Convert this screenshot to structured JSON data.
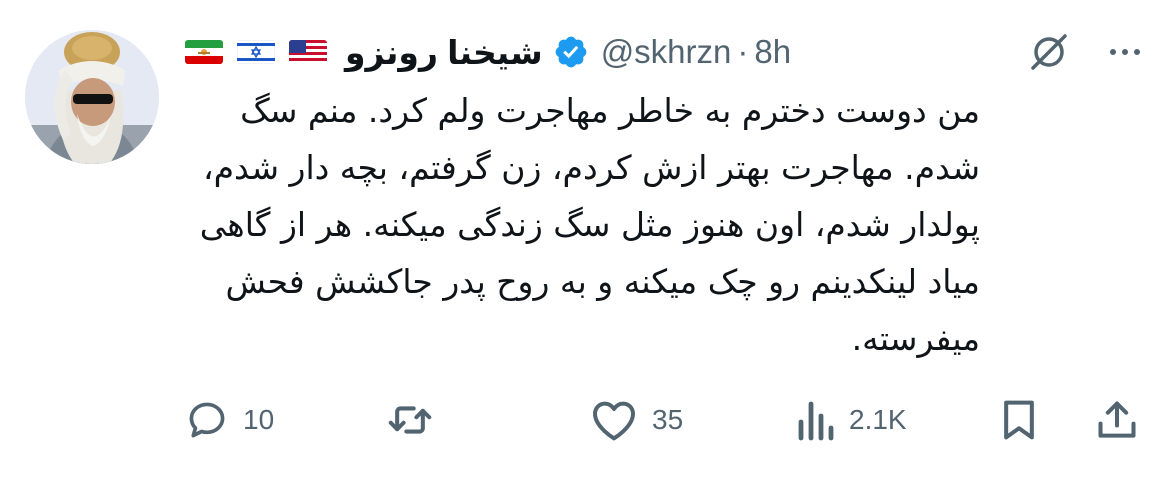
{
  "tweet": {
    "author": {
      "display_name": "شیخنا رونزو",
      "handle": "@skhrzn",
      "verified": true,
      "flags": [
        "iran-lion-sun-flag",
        "israel-flag",
        "usa-flag"
      ]
    },
    "separator": "·",
    "time": "8h",
    "text": "من دوست دخترم به خاطر مهاجرت ولم کرد. منم سگ شدم. مهاجرت بهتر ازش کردم، زن گرفتم، بچه دار شدم، پولدار شدم، اون هنوز مثل سگ زندگی میکنه. هر از گاهی میاد لینکدینم رو چک میکنه و به روح پدر جاکشش فحش میفرسته.",
    "stats": {
      "replies": "10",
      "reposts": "",
      "likes": "35",
      "views": "2.1K"
    }
  },
  "colors": {
    "text": "#0f1419",
    "secondary": "#536471",
    "verified_blue": "#1d9bf0"
  }
}
